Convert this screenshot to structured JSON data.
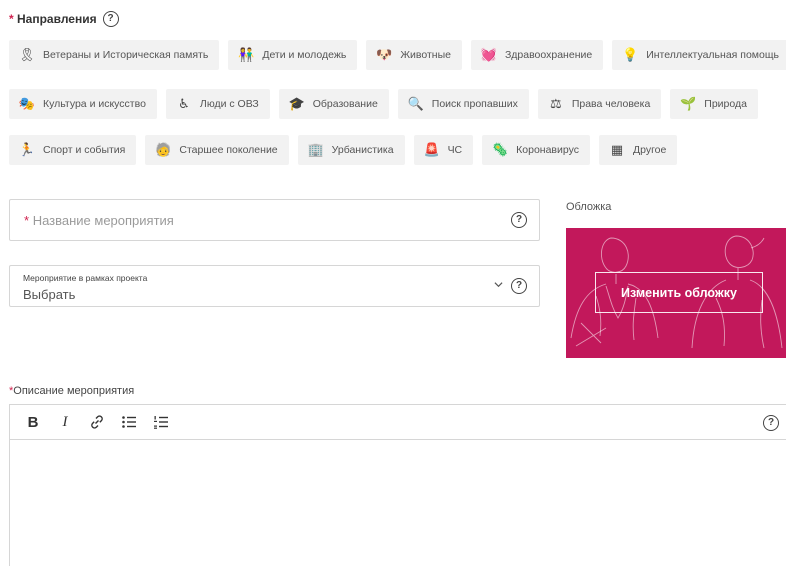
{
  "directions": {
    "required_mark": "*",
    "title": "Направления",
    "help": "?"
  },
  "chips": [
    [
      {
        "icon": "medal-icon",
        "glyph": "🎗",
        "label": "Ветераны и Историческая память"
      },
      {
        "icon": "children-icon",
        "glyph": "👫",
        "label": "Дети и молодежь"
      },
      {
        "icon": "paw-icon",
        "glyph": "🐶",
        "label": "Животные"
      },
      {
        "icon": "heart-pulse-icon",
        "glyph": "💓",
        "label": "Здравоохранение"
      },
      {
        "icon": "lightbulb-icon",
        "glyph": "💡",
        "label": "Интеллектуальная помощь"
      }
    ],
    [
      {
        "icon": "theater-icon",
        "glyph": "🎭",
        "label": "Культура и искусство"
      },
      {
        "icon": "wheelchair-icon",
        "glyph": "♿",
        "label": "Люди с ОВЗ"
      },
      {
        "icon": "graduation-cap-icon",
        "glyph": "🎓",
        "label": "Образование"
      },
      {
        "icon": "search-icon",
        "glyph": "🔍",
        "label": "Поиск пропавших"
      },
      {
        "icon": "scales-icon",
        "glyph": "⚖",
        "label": "Права человека"
      },
      {
        "icon": "sprout-icon",
        "glyph": "🌱",
        "label": "Природа"
      }
    ],
    [
      {
        "icon": "runner-icon",
        "glyph": "🏃",
        "label": "Спорт и события"
      },
      {
        "icon": "elder-icon",
        "glyph": "🧓",
        "label": "Старшее поколение"
      },
      {
        "icon": "building-icon",
        "glyph": "🏢",
        "label": "Урбанистика"
      },
      {
        "icon": "alarm-icon",
        "glyph": "🚨",
        "label": "ЧС"
      },
      {
        "icon": "virus-icon",
        "glyph": "🦠",
        "label": "Коронавирус"
      },
      {
        "icon": "grid-icon",
        "glyph": "▦",
        "label": "Другое"
      }
    ]
  ],
  "event_name": {
    "required_mark": "*",
    "placeholder": "Название мероприятия",
    "help": "?"
  },
  "project_select": {
    "small_label": "Мероприятие в рамках проекта",
    "value": "Выбрать",
    "help": "?"
  },
  "cover": {
    "label": "Обложка",
    "button_label": "Изменить обложку",
    "background_color": "#c2185b"
  },
  "description": {
    "required_mark": "*",
    "label": "Описание мероприятия",
    "help": "?",
    "toolbar": {
      "bold": "B",
      "italic": "I",
      "link_icon": "link-icon",
      "bullet_list_icon": "bullet-list-icon",
      "numbered_list_icon": "numbered-list-icon"
    }
  },
  "colors": {
    "accent": "#d0224f",
    "chip_bg": "#f2f2f2"
  }
}
